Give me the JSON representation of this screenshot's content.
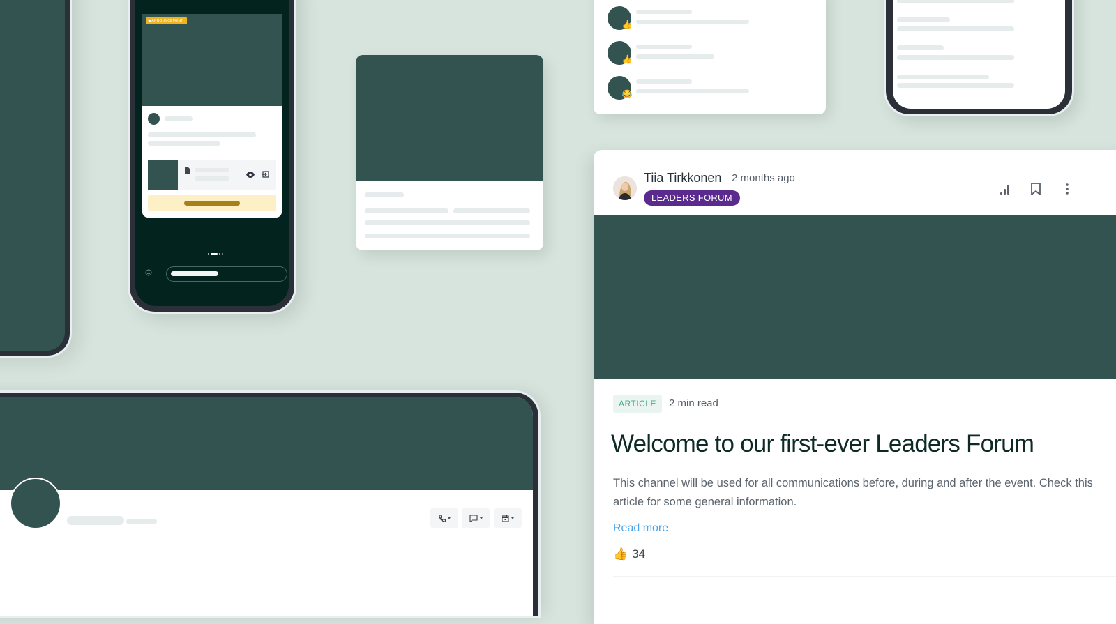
{
  "colors": {
    "background": "#d6e4dd",
    "brand_dark_green": "#335350",
    "device_frame": "#2a2f38",
    "channel_badge": "#5b2a8e",
    "article_badge_text": "#47a88f",
    "link": "#4aa3ea",
    "announcement_badge": "#efb320"
  },
  "phone_announcement": {
    "badge_label": "ANNOUNCEMENT",
    "badge_icon": "megaphone-icon",
    "attachment_icons": [
      "file-icon",
      "eye-icon",
      "open-icon"
    ],
    "composer_icon": "emoji-icon"
  },
  "reactions_list": {
    "items": [
      {
        "reaction": "👍",
        "reaction_name": "thumbs-up"
      },
      {
        "reaction": "👍",
        "reaction_name": "thumbs-up"
      },
      {
        "reaction": "😂",
        "reaction_name": "laughing"
      }
    ]
  },
  "profile_panel": {
    "actions": [
      {
        "icon": "phone-icon",
        "label": "Call"
      },
      {
        "icon": "chat-icon",
        "label": "Message"
      },
      {
        "icon": "calendar-icon",
        "label": "Schedule"
      }
    ]
  },
  "article": {
    "author": "Tiia Tirkkonen",
    "time_ago": "2 months ago",
    "channel": "LEADERS FORUM",
    "type": "ARTICLE",
    "read_time": "2 min read",
    "title": "Welcome to our first-ever Leaders Forum",
    "description": "This channel will be used for all communications before, during and after the event. Check this article for some general information.",
    "read_more": "Read more",
    "reaction_emoji": "👍",
    "reaction_count": "34",
    "toolbar_icons": [
      "analytics-icon",
      "bookmark-icon",
      "more-options-icon"
    ]
  }
}
